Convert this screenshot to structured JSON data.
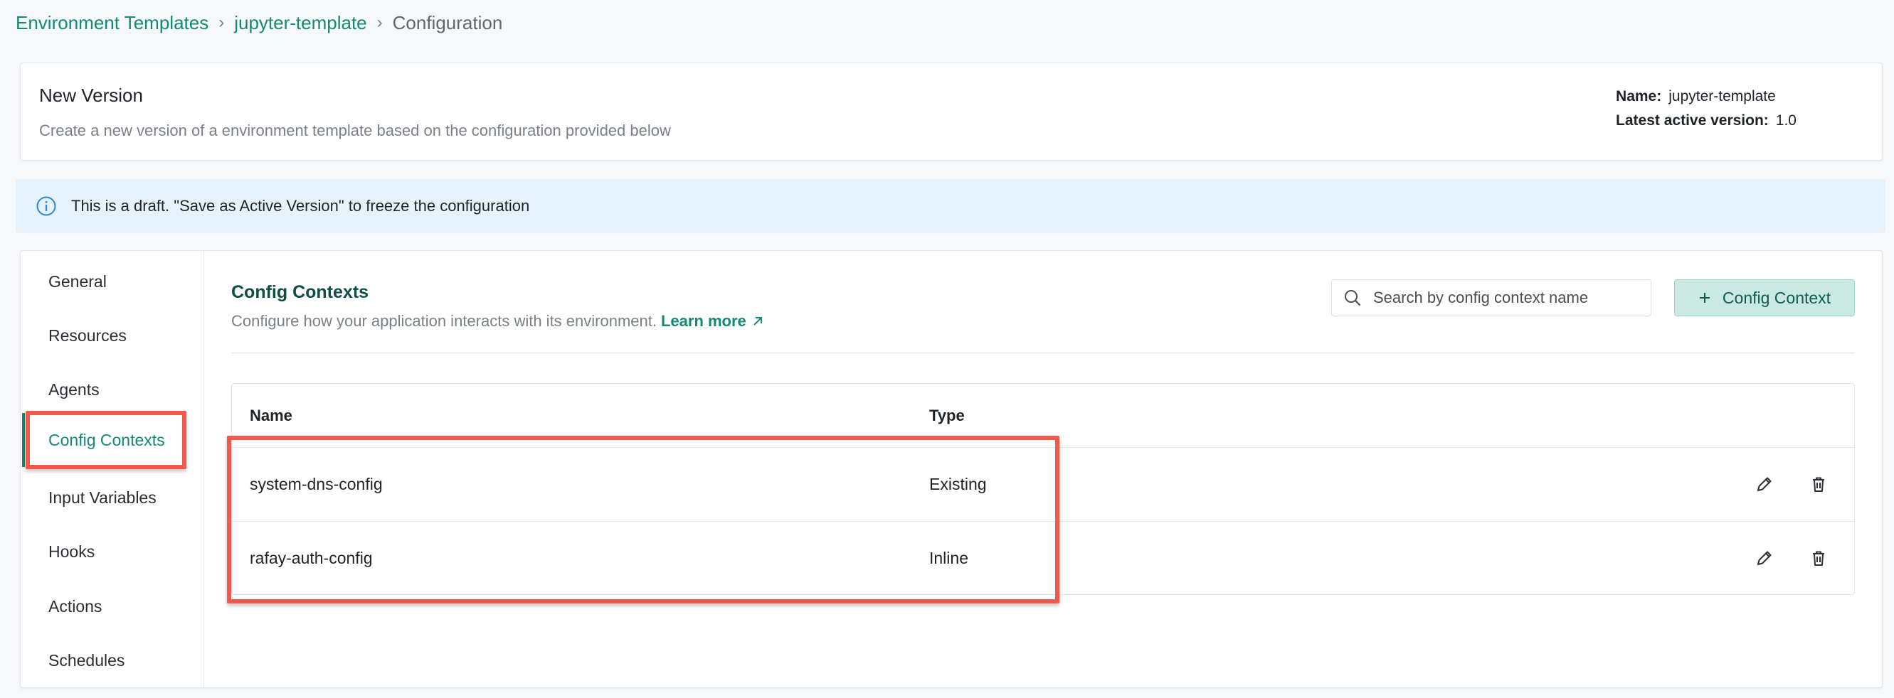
{
  "breadcrumb": {
    "items": [
      "Environment Templates",
      "jupyter-template"
    ],
    "current": "Configuration",
    "separator": "›"
  },
  "header": {
    "title": "New Version",
    "description": "Create a new version of a environment template based on the configuration provided below",
    "name_label": "Name:",
    "name_value": "jupyter-template",
    "version_label": "Latest active version:",
    "version_value": "1.0"
  },
  "alert": {
    "icon": "info-icon",
    "text": "This is a draft. \"Save as Active Version\" to freeze the configuration"
  },
  "sidebar": {
    "items": [
      {
        "label": "General"
      },
      {
        "label": "Resources"
      },
      {
        "label": "Agents"
      },
      {
        "label": "Config Contexts",
        "active": true
      },
      {
        "label": "Input Variables"
      },
      {
        "label": "Hooks"
      },
      {
        "label": "Actions"
      },
      {
        "label": "Schedules"
      }
    ]
  },
  "section": {
    "title": "Config Contexts",
    "description": "Configure how your application interacts with its environment.",
    "learn_more": "Learn more",
    "search_placeholder": "Search by config context name",
    "add_button": "Config Context"
  },
  "table": {
    "columns": [
      "Name",
      "Type"
    ],
    "rows": [
      {
        "name": "system-dns-config",
        "type": "Existing"
      },
      {
        "name": "rafay-auth-config",
        "type": "Inline"
      }
    ]
  },
  "colors": {
    "accent": "#138a73",
    "highlight": "#f0594b",
    "alert_bg": "#e6f2fb"
  }
}
